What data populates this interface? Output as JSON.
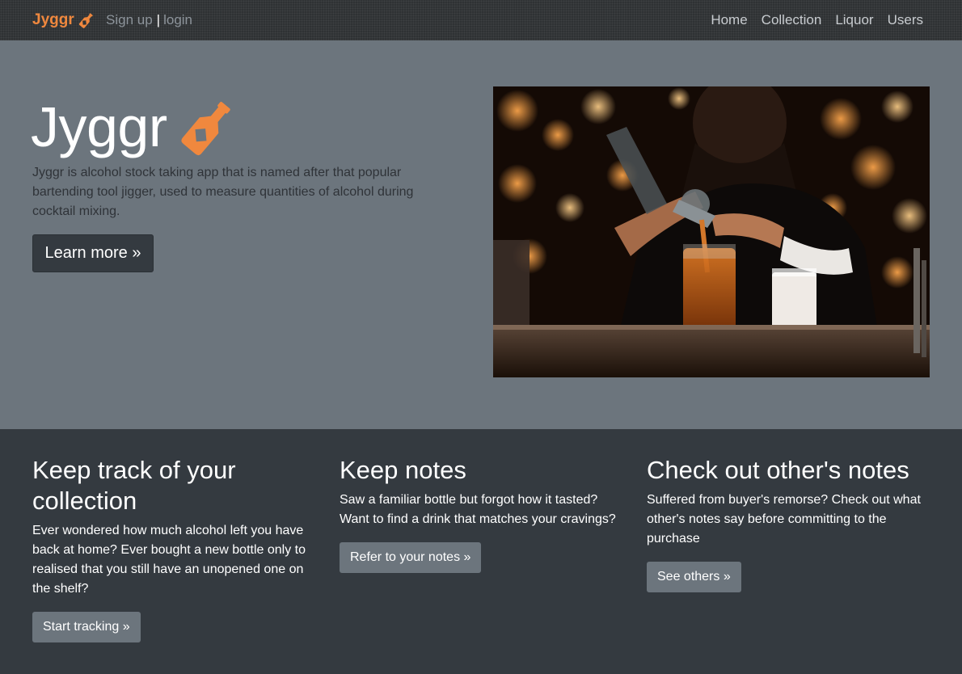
{
  "navbar": {
    "brand": "Jyggr",
    "signup": "Sign up",
    "separator": "|",
    "login": "login",
    "links": [
      "Home",
      "Collection",
      "Liquor",
      "Users"
    ]
  },
  "hero": {
    "title": "Jyggr",
    "description": "Jyggr is alcohol stock taking app that is named after that popular bartending tool jigger, used to measure quantities of alcohol during cocktail mixing.",
    "button": "Learn more »",
    "image_icon": "bartender-pouring-photo"
  },
  "features": [
    {
      "title": "Keep track of your collection",
      "text": "Ever wondered how much alcohol left you have back at home? Ever bought a new bottle only to realised that you still have an unopened one on the shelf?",
      "button": "Start tracking »"
    },
    {
      "title": "Keep notes",
      "text": "Saw a familiar bottle but forgot how it tasted? Want to find a drink that matches your cravings?",
      "button": "Refer to your notes »"
    },
    {
      "title": "Check out other's notes",
      "text": "Suffered from buyer's remorse? Check out what other's notes say before committing to the purchase",
      "button": "See others »"
    }
  ],
  "colors": {
    "brand": "#f0883e",
    "hero_bg": "#6c757d",
    "features_bg": "#343a40",
    "navbar_bg": "#2f3234",
    "secondary_button": "#6c757d"
  },
  "icons": {
    "brand_icon": "bottle-icon",
    "title_icon": "bottle-icon"
  }
}
